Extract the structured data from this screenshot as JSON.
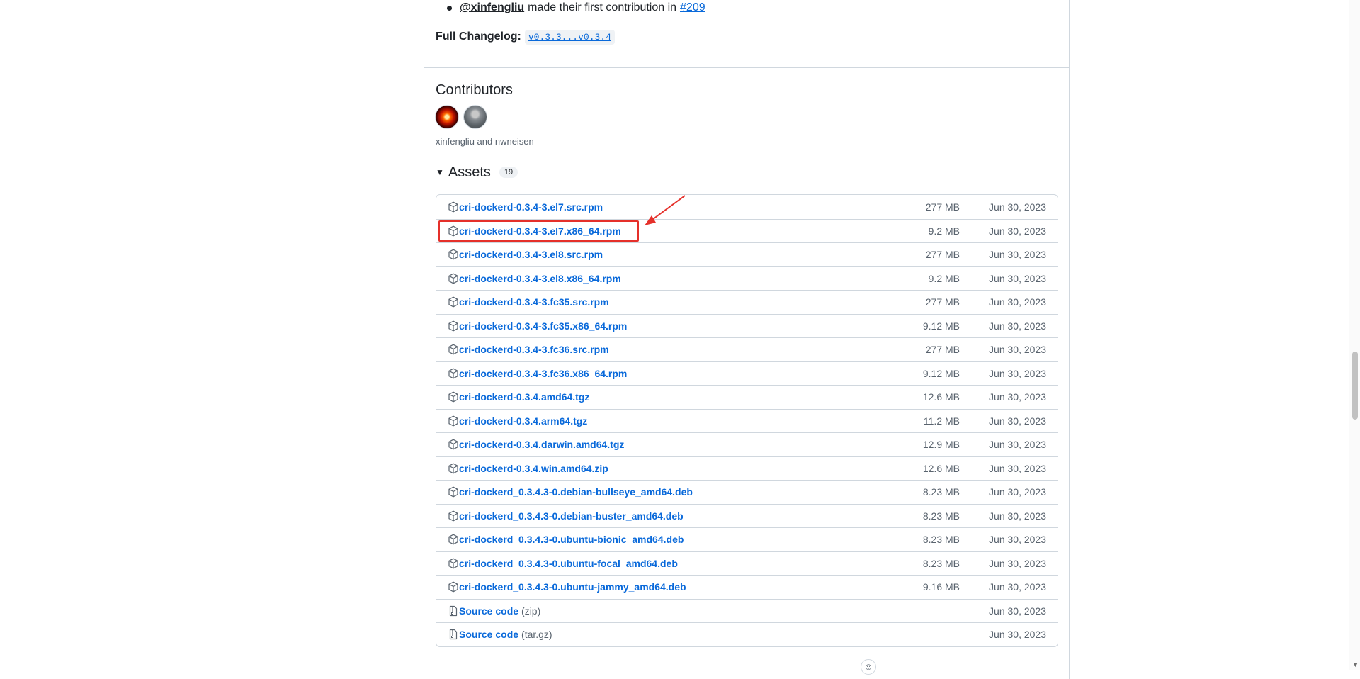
{
  "first_contribution": {
    "mention": "@xinfengliu",
    "text": "made their first contribution in",
    "pr_link": "#209"
  },
  "changelog": {
    "label": "Full Changelog:",
    "range": "v0.3.3...v0.3.4"
  },
  "contributors": {
    "heading": "Contributors",
    "names": "xinfengliu and nwneisen",
    "avatars": [
      "xinfengliu",
      "nwneisen"
    ]
  },
  "assets": {
    "title": "Assets",
    "count": "19",
    "rows": [
      {
        "name": "cri-dockerd-0.3.4-3.el7.src.rpm",
        "ext": "",
        "size": "277 MB",
        "date": "Jun 30, 2023",
        "icon": "package-icon"
      },
      {
        "name": "cri-dockerd-0.3.4-3.el7.x86_64.rpm",
        "ext": "",
        "size": "9.2 MB",
        "date": "Jun 30, 2023",
        "icon": "package-icon"
      },
      {
        "name": "cri-dockerd-0.3.4-3.el8.src.rpm",
        "ext": "",
        "size": "277 MB",
        "date": "Jun 30, 2023",
        "icon": "package-icon"
      },
      {
        "name": "cri-dockerd-0.3.4-3.el8.x86_64.rpm",
        "ext": "",
        "size": "9.2 MB",
        "date": "Jun 30, 2023",
        "icon": "package-icon"
      },
      {
        "name": "cri-dockerd-0.3.4-3.fc35.src.rpm",
        "ext": "",
        "size": "277 MB",
        "date": "Jun 30, 2023",
        "icon": "package-icon"
      },
      {
        "name": "cri-dockerd-0.3.4-3.fc35.x86_64.rpm",
        "ext": "",
        "size": "9.12 MB",
        "date": "Jun 30, 2023",
        "icon": "package-icon"
      },
      {
        "name": "cri-dockerd-0.3.4-3.fc36.src.rpm",
        "ext": "",
        "size": "277 MB",
        "date": "Jun 30, 2023",
        "icon": "package-icon"
      },
      {
        "name": "cri-dockerd-0.3.4-3.fc36.x86_64.rpm",
        "ext": "",
        "size": "9.12 MB",
        "date": "Jun 30, 2023",
        "icon": "package-icon"
      },
      {
        "name": "cri-dockerd-0.3.4.amd64.tgz",
        "ext": "",
        "size": "12.6 MB",
        "date": "Jun 30, 2023",
        "icon": "package-icon"
      },
      {
        "name": "cri-dockerd-0.3.4.arm64.tgz",
        "ext": "",
        "size": "11.2 MB",
        "date": "Jun 30, 2023",
        "icon": "package-icon"
      },
      {
        "name": "cri-dockerd-0.3.4.darwin.amd64.tgz",
        "ext": "",
        "size": "12.9 MB",
        "date": "Jun 30, 2023",
        "icon": "package-icon"
      },
      {
        "name": "cri-dockerd-0.3.4.win.amd64.zip",
        "ext": "",
        "size": "12.6 MB",
        "date": "Jun 30, 2023",
        "icon": "package-icon"
      },
      {
        "name": "cri-dockerd_0.3.4.3-0.debian-bullseye_amd64.deb",
        "ext": "",
        "size": "8.23 MB",
        "date": "Jun 30, 2023",
        "icon": "package-icon"
      },
      {
        "name": "cri-dockerd_0.3.4.3-0.debian-buster_amd64.deb",
        "ext": "",
        "size": "8.23 MB",
        "date": "Jun 30, 2023",
        "icon": "package-icon"
      },
      {
        "name": "cri-dockerd_0.3.4.3-0.ubuntu-bionic_amd64.deb",
        "ext": "",
        "size": "8.23 MB",
        "date": "Jun 30, 2023",
        "icon": "package-icon"
      },
      {
        "name": "cri-dockerd_0.3.4.3-0.ubuntu-focal_amd64.deb",
        "ext": "",
        "size": "8.23 MB",
        "date": "Jun 30, 2023",
        "icon": "package-icon"
      },
      {
        "name": "cri-dockerd_0.3.4.3-0.ubuntu-jammy_amd64.deb",
        "ext": "",
        "size": "9.16 MB",
        "date": "Jun 30, 2023",
        "icon": "package-icon"
      },
      {
        "name": "Source code",
        "ext": "(zip)",
        "size": "",
        "date": "Jun 30, 2023",
        "icon": "file-zip-icon"
      },
      {
        "name": "Source code",
        "ext": "(tar.gz)",
        "size": "",
        "date": "Jun 30, 2023",
        "icon": "file-zip-icon"
      }
    ]
  },
  "annotation": {
    "highlight_color": "#e5302a",
    "highlighted_asset": "cri-dockerd-0.3.4-3.el7.x86_64.rpm"
  },
  "colors": {
    "link": "#0969da",
    "muted": "#59636e",
    "border": "#d0d7de"
  }
}
